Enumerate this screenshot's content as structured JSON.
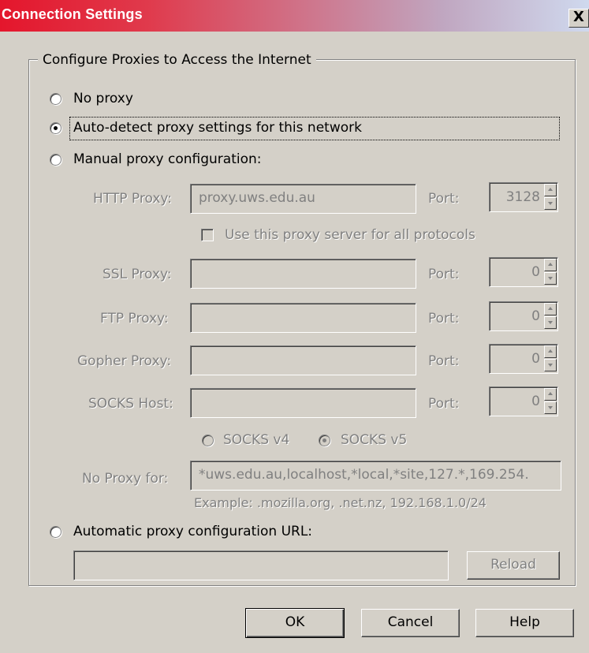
{
  "window": {
    "title": "Connection Settings",
    "close_glyph": "X"
  },
  "group": {
    "legend": "Configure Proxies to Access the Internet"
  },
  "options": {
    "no_proxy": "No proxy",
    "auto_detect": "Auto-detect proxy settings for this network",
    "manual": "Manual proxy configuration:",
    "auto_url": "Automatic proxy configuration URL:",
    "selected": "auto_detect"
  },
  "manual": {
    "http_label": "HTTP Proxy:",
    "http_value": "proxy.uws.edu.au",
    "http_port": "3128",
    "port_label": "Port:",
    "share_label": "Use this proxy server for all protocols",
    "share_checked": false,
    "ssl_label": "SSL Proxy:",
    "ssl_value": "",
    "ssl_port": "0",
    "ftp_label": "FTP Proxy:",
    "ftp_value": "",
    "ftp_port": "0",
    "gopher_label": "Gopher Proxy:",
    "gopher_value": "",
    "gopher_port": "0",
    "socks_label": "SOCKS Host:",
    "socks_value": "",
    "socks_port": "0",
    "socks_v4": "SOCKS v4",
    "socks_v5": "SOCKS v5",
    "socks_selected": "v5",
    "no_proxy_label": "No Proxy for:",
    "no_proxy_value": "*uws.edu.au,localhost,*local,*site,127.*,169.254.",
    "example": "Example: .mozilla.org, .net.nz, 192.168.1.0/24"
  },
  "auto_url": {
    "value": "",
    "reload_label": "Reload"
  },
  "buttons": {
    "ok": "OK",
    "cancel": "Cancel",
    "help": "Help"
  }
}
